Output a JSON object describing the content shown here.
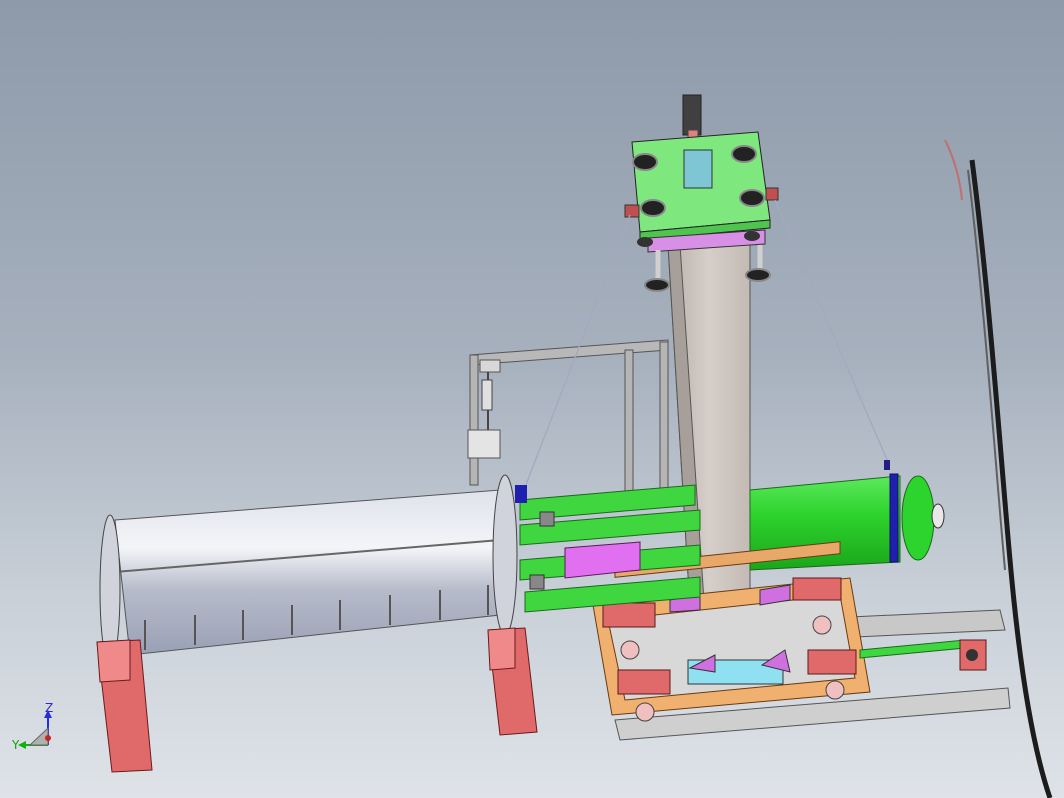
{
  "viewport": {
    "background_top": "#8e9aaa",
    "background_bottom": "#dfe3e8"
  },
  "triad": {
    "z_label": "Z",
    "y_label": "Y",
    "x_color": "#d02020",
    "y_color": "#10b010",
    "z_color": "#2030e0"
  },
  "model": {
    "colors": {
      "gray_tube": "#c9ccd8",
      "green_parts": "#3fd63f",
      "column": "#cfc6bf",
      "support_blocks": "#e06a6a",
      "frame_wood": "#e8a86a",
      "magenta_parts": "#d070e0",
      "cyan_parts": "#8fe0f0",
      "rail": "#c8c8c8"
    }
  }
}
